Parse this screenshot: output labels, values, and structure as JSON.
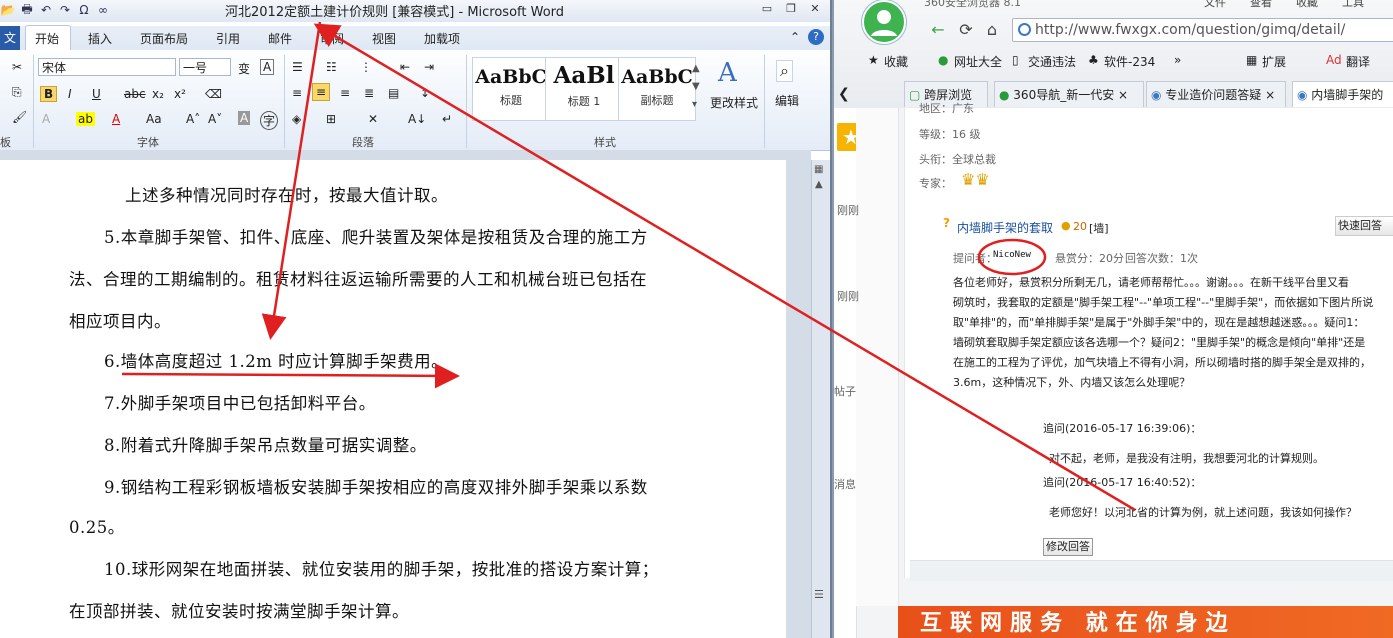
{
  "word": {
    "title": "河北2012定额土建计价规则 [兼容模式] - Microsoft Word",
    "file_tab": "文",
    "tabs": [
      "开始",
      "插入",
      "页面布局",
      "引用",
      "邮件",
      "审阅",
      "视图",
      "加载项"
    ],
    "font_name": "宋体",
    "font_size": "一号",
    "groups": {
      "clipboard": "板",
      "font": "字体",
      "paragraph": "段落",
      "styles": "样式"
    },
    "styles": [
      {
        "sample": "AaBbC",
        "name": "标题"
      },
      {
        "sample": "AaBl",
        "name": "标题 1"
      },
      {
        "sample": "AaBbC",
        "name": "副标题"
      }
    ],
    "change_styles": "更改样式",
    "editing": "编辑",
    "doc_lines": [
      "上述多种情况同时存在时，按最大值计取。",
      "5.本章脚手架管、扣件、底座、爬升装置及架体是按租赁及合理的施工方",
      "法、合理的工期编制的。租赁材料往返运输所需要的人工和机械台班已包括在",
      "相应项目内。",
      "6.墙体高度超过 1.2m 时应计算脚手架费用。",
      "7.外脚手架项目中已包括卸料平台。",
      "8.附着式升降脚手架吊点数量可据实调整。",
      "9.钢结构工程彩钢板墙板安装脚手架按相应的高度双排外脚手架乘以系数",
      "0.25。",
      "10.球形网架在地面拼装、就位安装用的脚手架，按批准的搭设方案计算；",
      "在顶部拼装、就位安装时按满堂脚手架计算。"
    ]
  },
  "browser": {
    "title": "360安全浏览器 8.1",
    "menu": [
      "文件",
      "查看",
      "收藏",
      "工具"
    ],
    "url": "http://www.fwxgx.com/question/gimq/detail/",
    "bookmarks": [
      "收藏",
      "网址大全",
      "交通违法",
      "软件-234",
      "扩展",
      "翻译"
    ],
    "tabs": [
      "跨屏浏览",
      "360导航_新一代安",
      "专业造价问题答疑",
      "内墙脚手架的"
    ],
    "side_labels": [
      "刚刚",
      "刚刚",
      "帖子",
      "消息"
    ],
    "profile": {
      "region": "地区：广东",
      "level": "等级：16 级",
      "rank": "头衔：全球总裁",
      "expert": "专家："
    },
    "question": {
      "title": "内墙脚手架的套取",
      "points": "20",
      "tag": "[墙]",
      "quick": "快速回答",
      "asker_label": "提问者：",
      "asker": "NicoNew",
      "reward": "悬赏分：20分",
      "answers": "回答次数：1次",
      "body": [
        "各位老师好，悬赏积分所剩无几，请老师帮帮忙。。。谢谢。。。在新干线平台里又看",
        "砌筑时，我套取的定额是\"脚手架工程\"--\"单项工程\"--\"里脚手架\"，而依据如下图片所说",
        "取\"单排\"的，而\"单排脚手架\"是属于\"外脚手架\"中的，现在是越想越迷惑。。。疑问1：",
        "墙砌筑套取脚手架定额应该各选哪一个？疑问2：\"里脚手架\"的概念是倾向\"单排\"还是",
        "在施工的工程为了评优，加气块墙上不得有小洞，所以砌墙时搭的脚手架全是双排的，",
        "3.6m，这种情况下，外、内墙又该怎么处理呢？"
      ]
    },
    "followups": [
      {
        "time": "追问(2016-05-17 16:39:06)：",
        "text": "对不起，老师，是我没有注明，我想要河北的计算规则。"
      },
      {
        "time": "追问(2016-05-17 16:40:52)：",
        "text": "老师您好！以河北省的计算为例，就上述问题，我该如何操作？"
      }
    ],
    "edit_answer": "修改回答",
    "banner": "互联网服务 就在你身边"
  }
}
